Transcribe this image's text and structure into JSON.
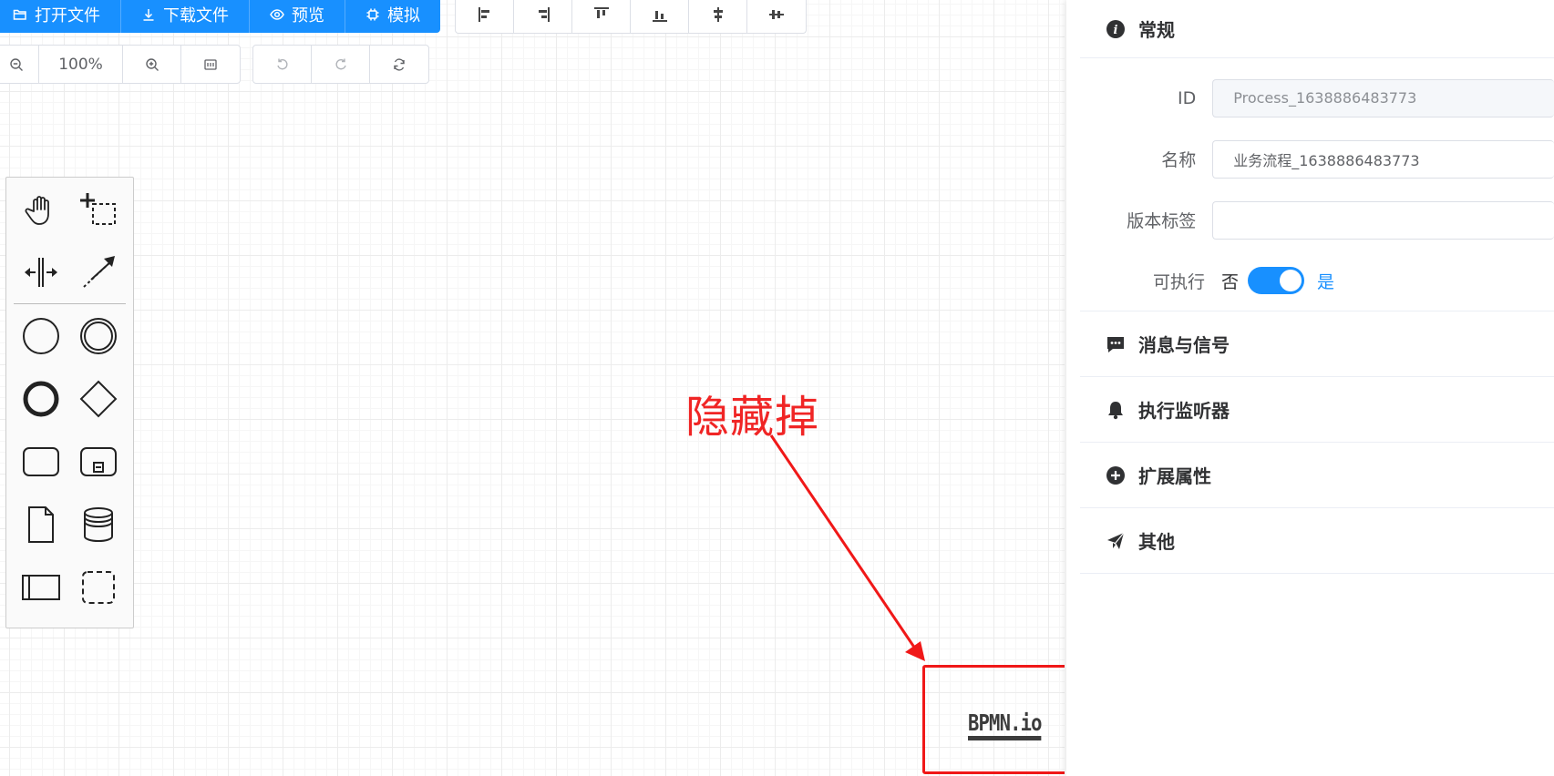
{
  "toolbar": {
    "primary": [
      {
        "label": "打开文件",
        "icon": "folder-open-icon"
      },
      {
        "label": "下载文件",
        "icon": "download-icon"
      },
      {
        "label": "预览",
        "icon": "eye-icon"
      },
      {
        "label": "模拟",
        "icon": "cpu-icon"
      }
    ],
    "align": [
      "align-left-icon",
      "align-right-icon",
      "align-top-icon",
      "align-bottom-icon",
      "align-center-icon",
      "align-middle-icon"
    ],
    "zoom": {
      "level": "100%"
    },
    "history": [
      "undo-icon",
      "redo-icon",
      "refresh-icon"
    ]
  },
  "palette": {
    "tools": [
      "hand-tool-icon",
      "lasso-tool-icon",
      "space-tool-icon",
      "connect-tool-icon",
      "start-event-icon",
      "intermediate-event-icon",
      "end-event-icon",
      "gateway-icon",
      "task-icon",
      "subprocess-icon",
      "data-object-icon",
      "data-store-icon",
      "participant-icon",
      "group-icon"
    ]
  },
  "annotation": {
    "text": "隐藏掉",
    "color": "#f02525"
  },
  "logo": {
    "text": "BPMN.io"
  },
  "panel": {
    "general": {
      "title": "常规",
      "id_label": "ID",
      "id_value": "Process_1638886483773",
      "name_label": "名称",
      "name_value": "业务流程_1638886483773",
      "version_label": "版本标签",
      "version_value": "",
      "executable_label": "可执行",
      "executable_off": "否",
      "executable_on": "是",
      "executable": true
    },
    "sections": [
      {
        "title": "消息与信号",
        "icon": "message-icon"
      },
      {
        "title": "执行监听器",
        "icon": "bell-icon"
      },
      {
        "title": "扩展属性",
        "icon": "plus-circle-icon"
      },
      {
        "title": "其他",
        "icon": "send-icon"
      }
    ]
  },
  "colors": {
    "primary": "#1890ff",
    "annotation": "#f01818"
  }
}
